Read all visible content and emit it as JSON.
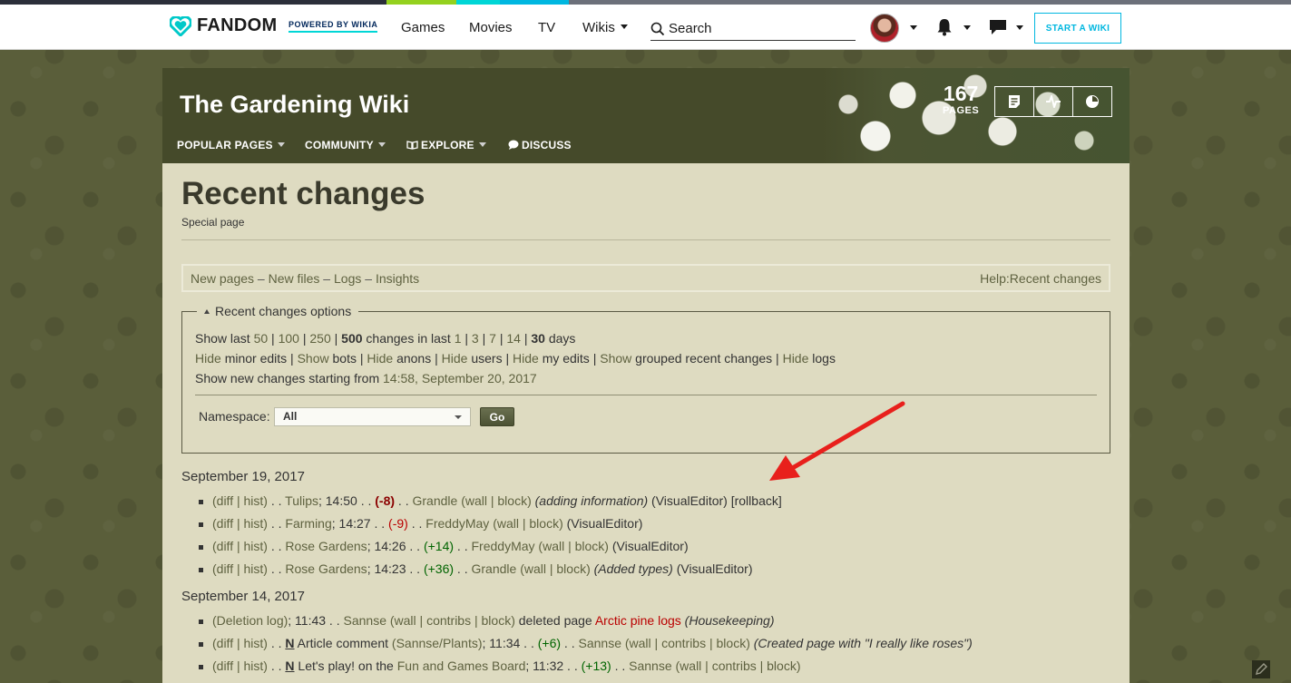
{
  "topbar": {
    "logo_text": "FANDOM",
    "powered_text": "POWERED BY WIKIA",
    "nav": [
      "Games",
      "Movies",
      "TV",
      "Wikis"
    ],
    "search_placeholder": "Search",
    "start_wiki": "START A WIKI",
    "stripe_colors": [
      "#2b2f3a",
      "#94d11e",
      "#00d6d6",
      "#00b7e0",
      "#6c707a"
    ]
  },
  "wiki": {
    "title": "The Gardening Wiki",
    "nav": [
      "POPULAR PAGES",
      "COMMUNITY",
      "EXPLORE",
      "DISCUSS"
    ],
    "pages_count": "167",
    "pages_label": "PAGES",
    "header_buttons": [
      "add-page-icon",
      "recent-activity-icon",
      "discussions-icon"
    ]
  },
  "page": {
    "title": "Recent changes",
    "subtitle": "Special page",
    "links": [
      "New pages",
      "New files",
      "Logs",
      "Insights"
    ],
    "help_link": "Help:Recent changes"
  },
  "options": {
    "legend": "Recent changes options",
    "show_last_prefix": "Show last",
    "limits": [
      "50",
      "100",
      "250",
      "500"
    ],
    "limits_selected": "500",
    "changes_in_last": "changes in last",
    "days": [
      "1",
      "3",
      "7",
      "14",
      "30"
    ],
    "days_selected": "30",
    "days_suffix": "days",
    "toggles": [
      {
        "action": "Hide",
        "label": "minor edits"
      },
      {
        "action": "Show",
        "label": "bots"
      },
      {
        "action": "Hide",
        "label": "anons"
      },
      {
        "action": "Hide",
        "label": "users"
      },
      {
        "action": "Hide",
        "label": "my edits"
      },
      {
        "action": "Show",
        "label": "grouped recent changes"
      },
      {
        "action": "Hide",
        "label": "logs"
      }
    ],
    "new_changes_text": "Show new changes starting from",
    "new_changes_link": "14:58, September 20, 2017",
    "namespace_label": "Namespace:",
    "namespace_value": "All",
    "go_label": "Go"
  },
  "days": [
    {
      "date": "September 19, 2017",
      "entries": [
        {
          "page": "Tulips",
          "time": "14:50",
          "delta": "(-8)",
          "delta_style": "bred",
          "user": "Grandle",
          "links": "(wall | block)",
          "summary": "(adding information)",
          "tag": "(VisualEditor)",
          "extra": "[rollback]"
        },
        {
          "page": "Farming",
          "time": "14:27",
          "delta": "(-9)",
          "delta_style": "red",
          "user": "FreddyMay",
          "links": "(wall | block)",
          "summary": "",
          "tag": "(VisualEditor)",
          "extra": ""
        },
        {
          "page": "Rose Gardens",
          "time": "14:26",
          "delta": "(+14)",
          "delta_style": "grn",
          "user": "FreddyMay",
          "links": "(wall | block)",
          "summary": "",
          "tag": "(VisualEditor)",
          "extra": ""
        },
        {
          "page": "Rose Gardens",
          "time": "14:23",
          "delta": "(+36)",
          "delta_style": "grn",
          "user": "Grandle",
          "links": "(wall | block)",
          "summary": "(Added types)",
          "tag": "(VisualEditor)",
          "extra": ""
        }
      ]
    },
    {
      "date": "September 14, 2017",
      "log_entry": {
        "log": "(Deletion log)",
        "time": "11:43",
        "user": "Sannse",
        "links": "(wall | contribs | block)",
        "action": "deleted page",
        "target": "Arctic pine logs",
        "summary": "(Housekeeping)"
      },
      "entries": [
        {
          "new": "N",
          "page": "Article comment",
          "page_extra": "(Sannse/Plants)",
          "time": "11:34",
          "delta": "(+6)",
          "delta_style": "grn",
          "user": "Sannse",
          "links": "(wall | contribs | block)",
          "summary": "(Created page with \"I really like roses\")"
        },
        {
          "new": "N",
          "page": "Let's play! on the",
          "page_extra": "Fun and Games Board",
          "time": "11:32",
          "delta": "(+13)",
          "delta_style": "grn",
          "user": "Sannse",
          "links": "(wall | contribs | block)",
          "summary": ""
        }
      ]
    }
  ],
  "rc_prefix": "(diff | hist)",
  "colors": {
    "background": "#5a5e3a",
    "content": "#dedbc1",
    "header": "#454a2a",
    "link": "#5f6240",
    "accent_fandom": "#00b7e0",
    "arrow": "#e8201c"
  }
}
